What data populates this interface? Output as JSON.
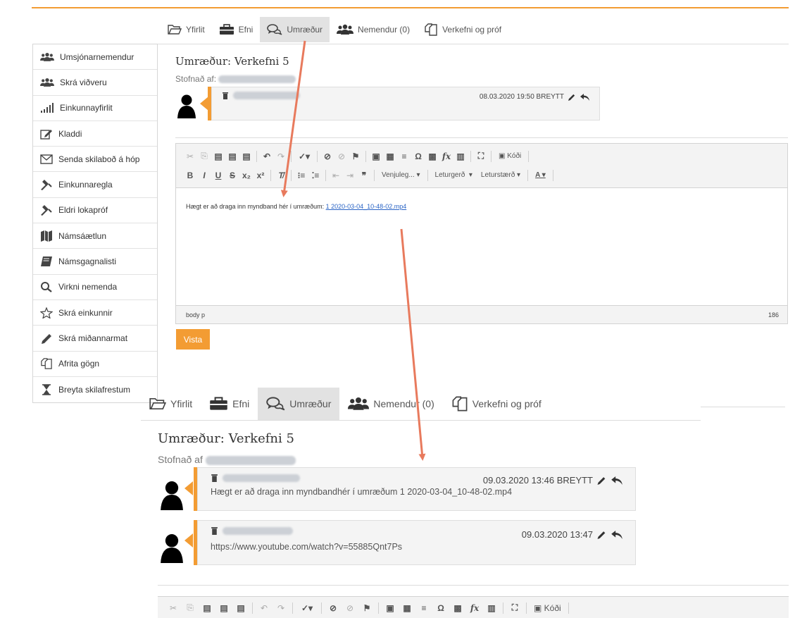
{
  "tabs_top": [
    {
      "label": "Yfirlit",
      "icon": "folder-open-icon",
      "active": false
    },
    {
      "label": "Efni",
      "icon": "briefcase-icon",
      "active": false
    },
    {
      "label": "Umræður",
      "icon": "comments-icon",
      "active": true
    },
    {
      "label": "Nemendur (0)",
      "icon": "users-icon",
      "active": false
    },
    {
      "label": "Verkefni og próf",
      "icon": "copy-icon",
      "active": false
    }
  ],
  "tabs_bottom": [
    {
      "label": "Yfirlit",
      "icon": "folder-open-icon",
      "active": false
    },
    {
      "label": "Efni",
      "icon": "briefcase-icon",
      "active": false
    },
    {
      "label": "Umræður",
      "icon": "comments-icon",
      "active": true
    },
    {
      "label": "Nemendur (0)",
      "icon": "users-icon",
      "active": false
    },
    {
      "label": "Verkefni og próf",
      "icon": "copy-icon",
      "active": false
    }
  ],
  "sidebar": {
    "items": [
      {
        "label": "Umsjónarnemendur",
        "icon": "users-icon"
      },
      {
        "label": "Skrá viðveru",
        "icon": "users-icon"
      },
      {
        "label": "Einkunnayfirlit",
        "icon": "signal-bars-icon"
      },
      {
        "label": "Kladdi",
        "icon": "edit-icon"
      },
      {
        "label": "Senda skilaboð á hóp",
        "icon": "envelope-icon"
      },
      {
        "label": "Einkunnaregla",
        "icon": "gavel-icon"
      },
      {
        "label": "Eldri lokapróf",
        "icon": "gavel-icon"
      },
      {
        "label": "Námsáætlun",
        "icon": "map-icon"
      },
      {
        "label": "Námsgagnalisti",
        "icon": "book-icon"
      },
      {
        "label": "Virkni nemenda",
        "icon": "search-icon"
      },
      {
        "label": "Skrá einkunnir",
        "icon": "star-icon"
      },
      {
        "label": "Skrá miðannarmat",
        "icon": "pencil-icon"
      },
      {
        "label": "Afrita gögn",
        "icon": "copy-icon"
      },
      {
        "label": "Breyta skilafrestum",
        "icon": "hourglass-icon"
      }
    ]
  },
  "top_section": {
    "title": "Umræður: Verkefni 5",
    "created_label": "Stofnað af:",
    "post": {
      "timestamp": "08.03.2020 19:50 BREYTT"
    }
  },
  "editor": {
    "toolbar_combos": {
      "format": "Venjuleg...",
      "font": "Leturgerð",
      "size": "Leturstærð",
      "color": "A",
      "source": "Kóði"
    },
    "body_text": "Hægt er að draga inn myndband hér í umræðum:",
    "link_text": "1 2020-03-04_10-48-02.mp4",
    "status_path": "body  p",
    "word_count": "186"
  },
  "save_button": "Vista",
  "bottom_section": {
    "title": "Umræður: Verkefni 5",
    "created_label": "Stofnað af",
    "posts": [
      {
        "timestamp": "09.03.2020 13:46 BREYTT",
        "text": "Hægt er að draga inn myndbandhér í umræðum 1 2020-03-04_10-48-02.mp4"
      },
      {
        "timestamp": "09.03.2020 13:47",
        "text": "https://www.youtube.com/watch?v=55885Qnt7Ps"
      }
    ],
    "toolbar_source": "Kóði"
  },
  "colors": {
    "accent": "#f39c33",
    "annotation_arrow": "#e87a5d"
  }
}
